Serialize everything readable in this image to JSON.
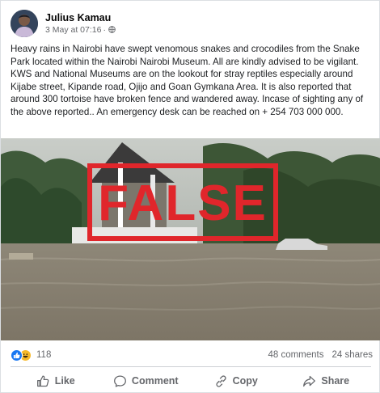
{
  "post": {
    "author": "Julius Kamau",
    "date": "3 May at 07:16",
    "separator": "·",
    "text": "Heavy rains in Nairobi have swept venomous snakes and crocodiles from the Snake Park located within the  Nairobi Nairobi Museum. All are  kindly  advised to be vigilant. KWS and National Museums are on the lookout for stray reptiles especially around Kijabe street, Kipande road, Ojijo and Goan Gymkana Area. It is also reported that around 300 tortoise have broken fence and wandered away. Incase of sighting any of the above reported.. An emergency desk can be reached on + 254 703 000 000.",
    "privacy_icon": "globe-icon"
  },
  "image": {
    "stamp_text": "FALSE",
    "stamp_color": "#e0262b"
  },
  "reactions": {
    "count": "118",
    "comments": "48 comments",
    "shares": "24 shares",
    "icons": [
      "like-icon",
      "haha-icon"
    ]
  },
  "actions": {
    "like": "Like",
    "comment": "Comment",
    "copy": "Copy",
    "share": "Share"
  }
}
